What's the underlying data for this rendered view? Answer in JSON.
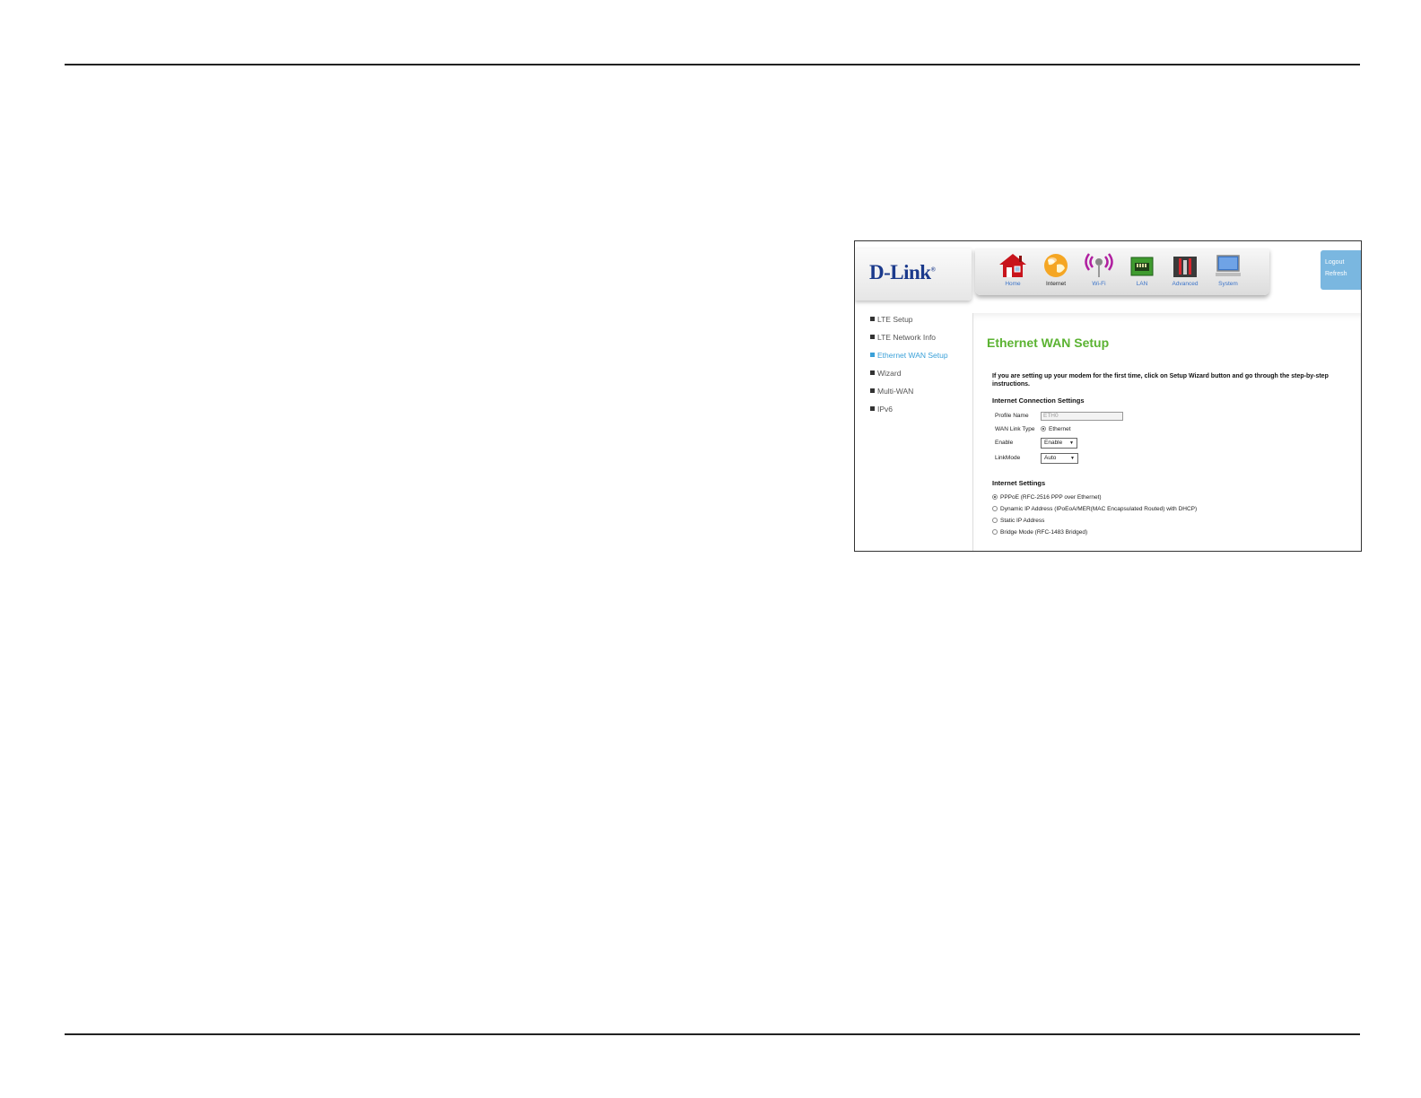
{
  "brand": {
    "logo": "D-Link",
    "mark": "®"
  },
  "nav": [
    {
      "label": "Home",
      "icon": "home-icon",
      "active": false
    },
    {
      "label": "Internet",
      "icon": "globe-icon",
      "active": true
    },
    {
      "label": "Wi-Fi",
      "icon": "wifi-icon",
      "active": false
    },
    {
      "label": "LAN",
      "icon": "lan-icon",
      "active": false
    },
    {
      "label": "Advanced",
      "icon": "tools-icon",
      "active": false
    },
    {
      "label": "System",
      "icon": "monitor-icon",
      "active": false
    }
  ],
  "session": {
    "logout": "Logout",
    "refresh": "Refresh"
  },
  "sidebar": {
    "items": [
      {
        "label": "LTE Setup",
        "active": false
      },
      {
        "label": "LTE Network Info",
        "active": false
      },
      {
        "label": "Ethernet WAN Setup",
        "active": true
      },
      {
        "label": "Wizard",
        "active": false
      },
      {
        "label": "Multi-WAN",
        "active": false
      },
      {
        "label": "IPv6",
        "active": false
      }
    ]
  },
  "main": {
    "title": "Ethernet WAN Setup",
    "intro": "If you are setting up your modem for the first time, click on Setup Wizard button and go through the step-by-step instructions.",
    "connection": {
      "title": "Internet Connection Settings",
      "profile_name_label": "Profile Name",
      "profile_name_value": "ETH0",
      "wan_link_type_label": "WAN Link Type",
      "wan_link_type_value": "Ethernet",
      "enable_label": "Enable",
      "enable_value": "Enable",
      "linkmode_label": "LinkMode",
      "linkmode_value": "Auto"
    },
    "internet": {
      "title": "Internet Settings",
      "options": [
        {
          "label": "PPPoE (RFC-2516 PPP over Ethernet)",
          "selected": true
        },
        {
          "label": "Dynamic IP Address (IPoEoA/MER(MAC Encapsulated Routed) with DHCP)",
          "selected": false
        },
        {
          "label": "Static IP Address",
          "selected": false
        },
        {
          "label": "Bridge Mode (RFC-1483 Bridged)",
          "selected": false
        }
      ]
    }
  },
  "colors": {
    "accent_green": "#5bb332",
    "link_blue": "#3aa0d8",
    "brand_blue": "#1b3a8c",
    "logout_bg": "#7ab7e0"
  }
}
